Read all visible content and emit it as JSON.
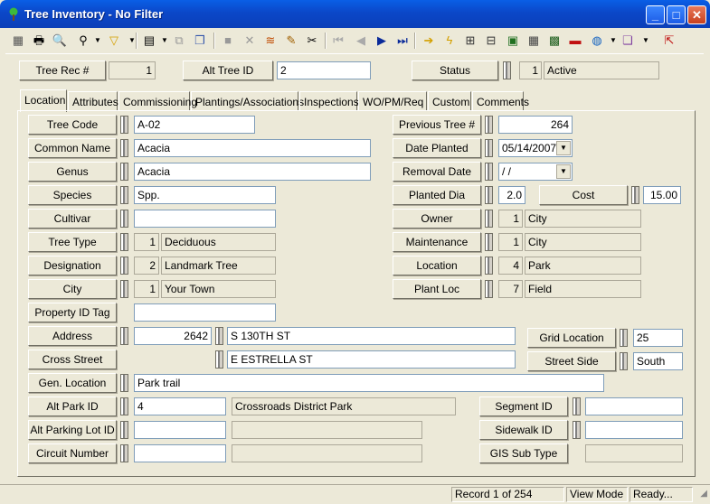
{
  "window": {
    "title": "Tree Inventory - No Filter"
  },
  "header": {
    "tree_rec_label": "Tree Rec #",
    "tree_rec_value": "1",
    "alt_tree_label": "Alt Tree ID",
    "alt_tree_value": "2",
    "status_label": "Status",
    "status_code": "1",
    "status_text": "Active"
  },
  "tabs": [
    "Location",
    "Attributes",
    "Commissioning",
    "Plantings/Associations",
    "Inspections",
    "WO/PM/Req",
    "Custom",
    "Comments"
  ],
  "left": {
    "tree_code": {
      "label": "Tree Code",
      "value": "A-02"
    },
    "common_name": {
      "label": "Common Name",
      "value": "Acacia"
    },
    "genus": {
      "label": "Genus",
      "value": "Acacia"
    },
    "species": {
      "label": "Species",
      "value": "Spp."
    },
    "cultivar": {
      "label": "Cultivar",
      "value": ""
    },
    "tree_type": {
      "label": "Tree Type",
      "code": "1",
      "text": "Deciduous"
    },
    "designation": {
      "label": "Designation",
      "code": "2",
      "text": "Landmark Tree"
    },
    "city": {
      "label": "City",
      "code": "1",
      "text": "Your Town"
    },
    "property_id": {
      "label": "Property ID Tag",
      "value": ""
    },
    "address": {
      "label": "Address",
      "number": "2642",
      "street": "S 130TH ST"
    },
    "cross_street": {
      "label": "Cross Street",
      "value": "E ESTRELLA ST"
    },
    "gen_location": {
      "label": "Gen. Location",
      "value": "Park trail"
    },
    "alt_park": {
      "label": "Alt Park ID",
      "code": "4",
      "text": "Crossroads District Park"
    },
    "alt_parking": {
      "label": "Alt Parking Lot ID",
      "code": "",
      "text": ""
    },
    "circuit": {
      "label": "Circuit Number",
      "code": "",
      "text": ""
    }
  },
  "right": {
    "previous_tree": {
      "label": "Previous Tree #",
      "value": "264"
    },
    "date_planted": {
      "label": "Date Planted",
      "value": "05/14/2007"
    },
    "removal_date": {
      "label": "Removal Date",
      "value": " /  /"
    },
    "planted_dia": {
      "label": "Planted Dia",
      "value": "2.0"
    },
    "cost": {
      "label": "Cost",
      "value": "15.00"
    },
    "owner": {
      "label": "Owner",
      "code": "1",
      "text": "City"
    },
    "maintenance": {
      "label": "Maintenance",
      "code": "1",
      "text": "City"
    },
    "location": {
      "label": "Location",
      "code": "4",
      "text": "Park"
    },
    "plant_loc": {
      "label": "Plant Loc",
      "code": "7",
      "text": "Field"
    },
    "grid_location": {
      "label": "Grid Location",
      "value": "25"
    },
    "street_side": {
      "label": "Street Side",
      "value": "South"
    },
    "segment_id": {
      "label": "Segment ID",
      "value": ""
    },
    "sidewalk_id": {
      "label": "Sidewalk ID",
      "value": ""
    },
    "gis_sub_type": {
      "label": "GIS Sub Type",
      "value": ""
    }
  },
  "statusbar": {
    "record": "Record 1 of 254",
    "mode": "View Mode",
    "state": "Ready..."
  },
  "colors": {
    "titlebar": "#0b47c8",
    "face": "#ece9d8"
  }
}
